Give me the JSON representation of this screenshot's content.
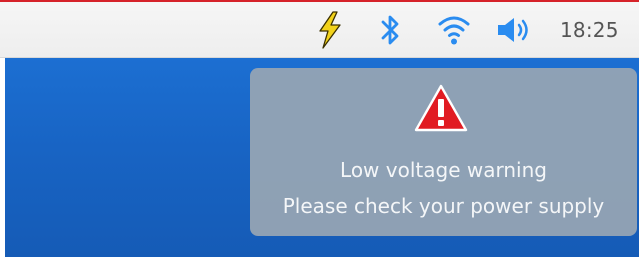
{
  "status_bar": {
    "icons": [
      "lightning-icon",
      "bluetooth-icon",
      "wifi-icon",
      "volume-icon"
    ],
    "time": "18:25"
  },
  "notification": {
    "icon": "warning-icon",
    "title": "Low voltage warning",
    "message": "Please check your power supply"
  },
  "colors": {
    "status_bar_bg": "#f2f2f2",
    "desktop_bg": "#1866c8",
    "accent_blue": "#2a8cf0",
    "lightning_yellow": "#f2d21b",
    "warning_red": "#e11b22",
    "toast_bg": "#96a5b4"
  }
}
